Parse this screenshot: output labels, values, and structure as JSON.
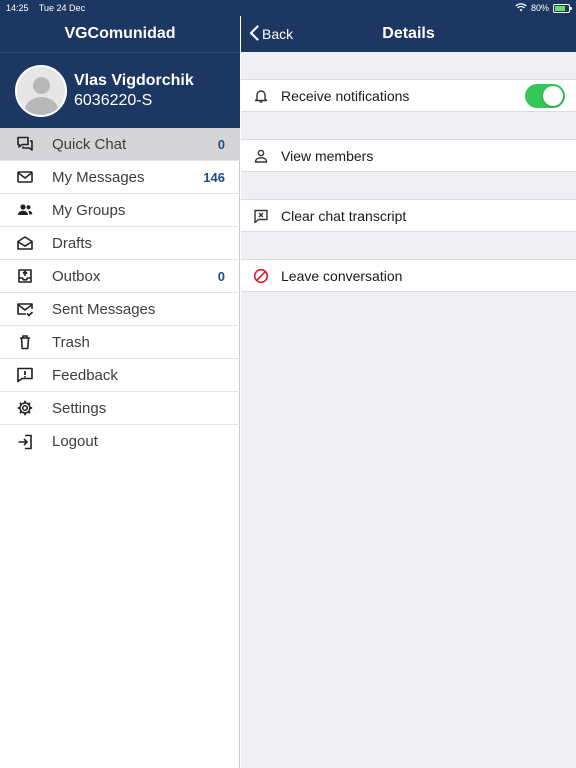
{
  "status_bar": {
    "time": "14:25",
    "date": "Tue 24 Dec",
    "battery": "80%",
    "battery_level": 0.8
  },
  "left": {
    "title": "VGComunidad",
    "profile": {
      "name": "Vlas Vigdorchik",
      "id": "6036220-S"
    },
    "menu": [
      {
        "label": "Quick Chat",
        "count": "0",
        "icon": "chat-icon"
      },
      {
        "label": "My Messages",
        "count": "146",
        "icon": "mail-icon"
      },
      {
        "label": "My Groups",
        "count": "",
        "icon": "group-icon"
      },
      {
        "label": "Drafts",
        "count": "",
        "icon": "open-mail-icon"
      },
      {
        "label": "Outbox",
        "count": "0",
        "icon": "outbox-icon"
      },
      {
        "label": "Sent Messages",
        "count": "",
        "icon": "sent-mail-icon"
      },
      {
        "label": "Trash",
        "count": "",
        "icon": "trash-icon"
      },
      {
        "label": "Feedback",
        "count": "",
        "icon": "feedback-icon"
      },
      {
        "label": "Settings",
        "count": "",
        "icon": "gear-icon"
      },
      {
        "label": "Logout",
        "count": "",
        "icon": "logout-icon"
      }
    ]
  },
  "right": {
    "back_label": "Back",
    "title": "Details",
    "rows": [
      {
        "label": "Receive notifications",
        "icon": "bell-icon"
      },
      {
        "label": "View members",
        "icon": "person-icon"
      },
      {
        "label": "Clear chat transcript",
        "icon": "clear-chat-icon"
      },
      {
        "label": "Leave conversation",
        "icon": "block-icon"
      }
    ],
    "notifications_enabled": true
  },
  "colors": {
    "header": "#1c3762",
    "accent_count": "#1d4f86",
    "toggle_on": "#34c759",
    "leave_icon": "#e0182d"
  }
}
